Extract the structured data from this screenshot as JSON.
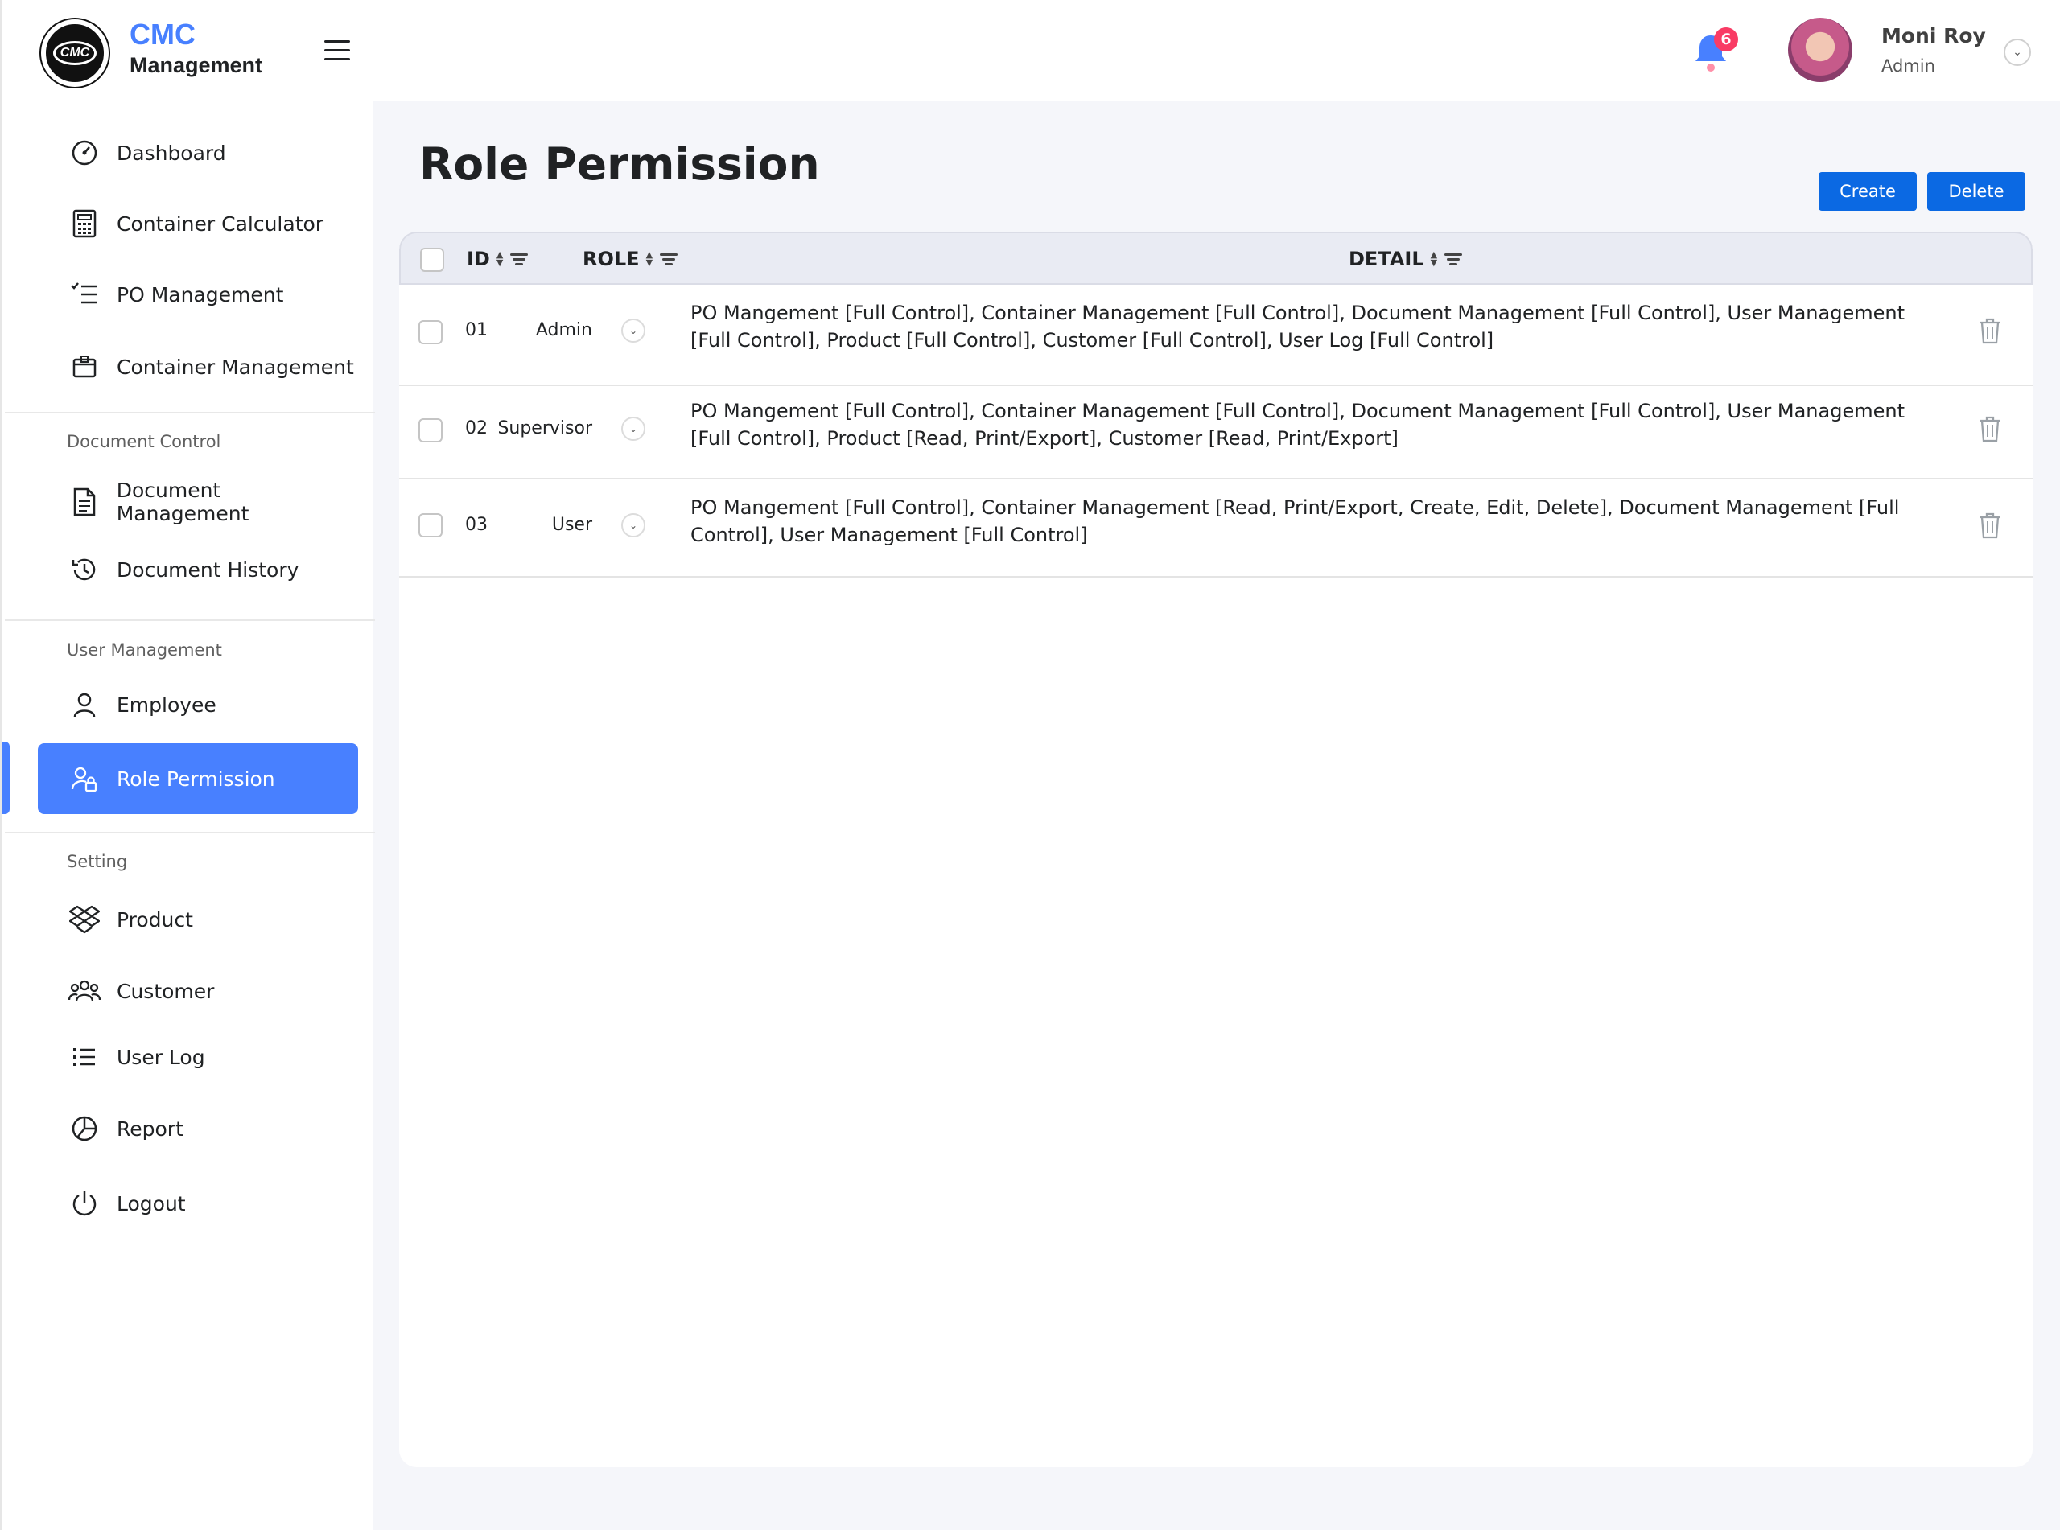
{
  "brand": {
    "line1": "CMC",
    "line2": "Management",
    "logo_text": "CMC"
  },
  "sidebar": {
    "items": [
      {
        "label": "Dashboard",
        "icon": "dashboard-icon"
      },
      {
        "label": "Container Calculator",
        "icon": "calculator-icon"
      },
      {
        "label": "PO Management",
        "icon": "checklist-icon"
      },
      {
        "label": "Container Management",
        "icon": "box-icon"
      }
    ],
    "sections": [
      {
        "title": "Document Control",
        "items": [
          {
            "label": "Document Management",
            "icon": "document-icon"
          },
          {
            "label": "Document History",
            "icon": "history-icon"
          }
        ]
      },
      {
        "title": "User Management",
        "items": [
          {
            "label": "Employee",
            "icon": "user-icon"
          },
          {
            "label": "Role Permission",
            "icon": "user-lock-icon",
            "active": true
          }
        ]
      },
      {
        "title": "Setting",
        "items": [
          {
            "label": "Product",
            "icon": "dropbox-icon"
          },
          {
            "label": "Customer",
            "icon": "group-icon"
          },
          {
            "label": "User Log",
            "icon": "list-icon"
          },
          {
            "label": "Report",
            "icon": "pie-icon"
          },
          {
            "label": "Logout",
            "icon": "power-icon"
          }
        ]
      }
    ]
  },
  "header": {
    "notification_count": "6",
    "user_name": "Moni Roy",
    "user_role": "Admin"
  },
  "main": {
    "title": "Role Permission",
    "create_label": "Create",
    "delete_label": "Delete",
    "columns": {
      "id": "ID",
      "role": "ROLE",
      "detail": "DETAIL"
    },
    "rows": [
      {
        "id": "01",
        "role": "Admin",
        "detail": "PO Mangement [Full Control], Container Management [Full Control], Document Management [Full Control], User Management [Full Control], Product [Full Control], Customer [Full Control], User Log [Full Control]"
      },
      {
        "id": "02",
        "role": "Supervisor",
        "detail": "PO Mangement [Full Control], Container Management [Full Control], Document Management [Full Control], User Management [Full Control], Product [Read, Print/Export], Customer [Read, Print/Export]"
      },
      {
        "id": "03",
        "role": "User",
        "detail": "PO Mangement [Full Control], Container Management [Read, Print/Export, Create, Edit, Delete], Document Management [Full Control], User Management [Full Control]"
      }
    ]
  },
  "colors": {
    "accent": "#4880ff",
    "button": "#0b69e3",
    "badge": "#f93c65"
  }
}
